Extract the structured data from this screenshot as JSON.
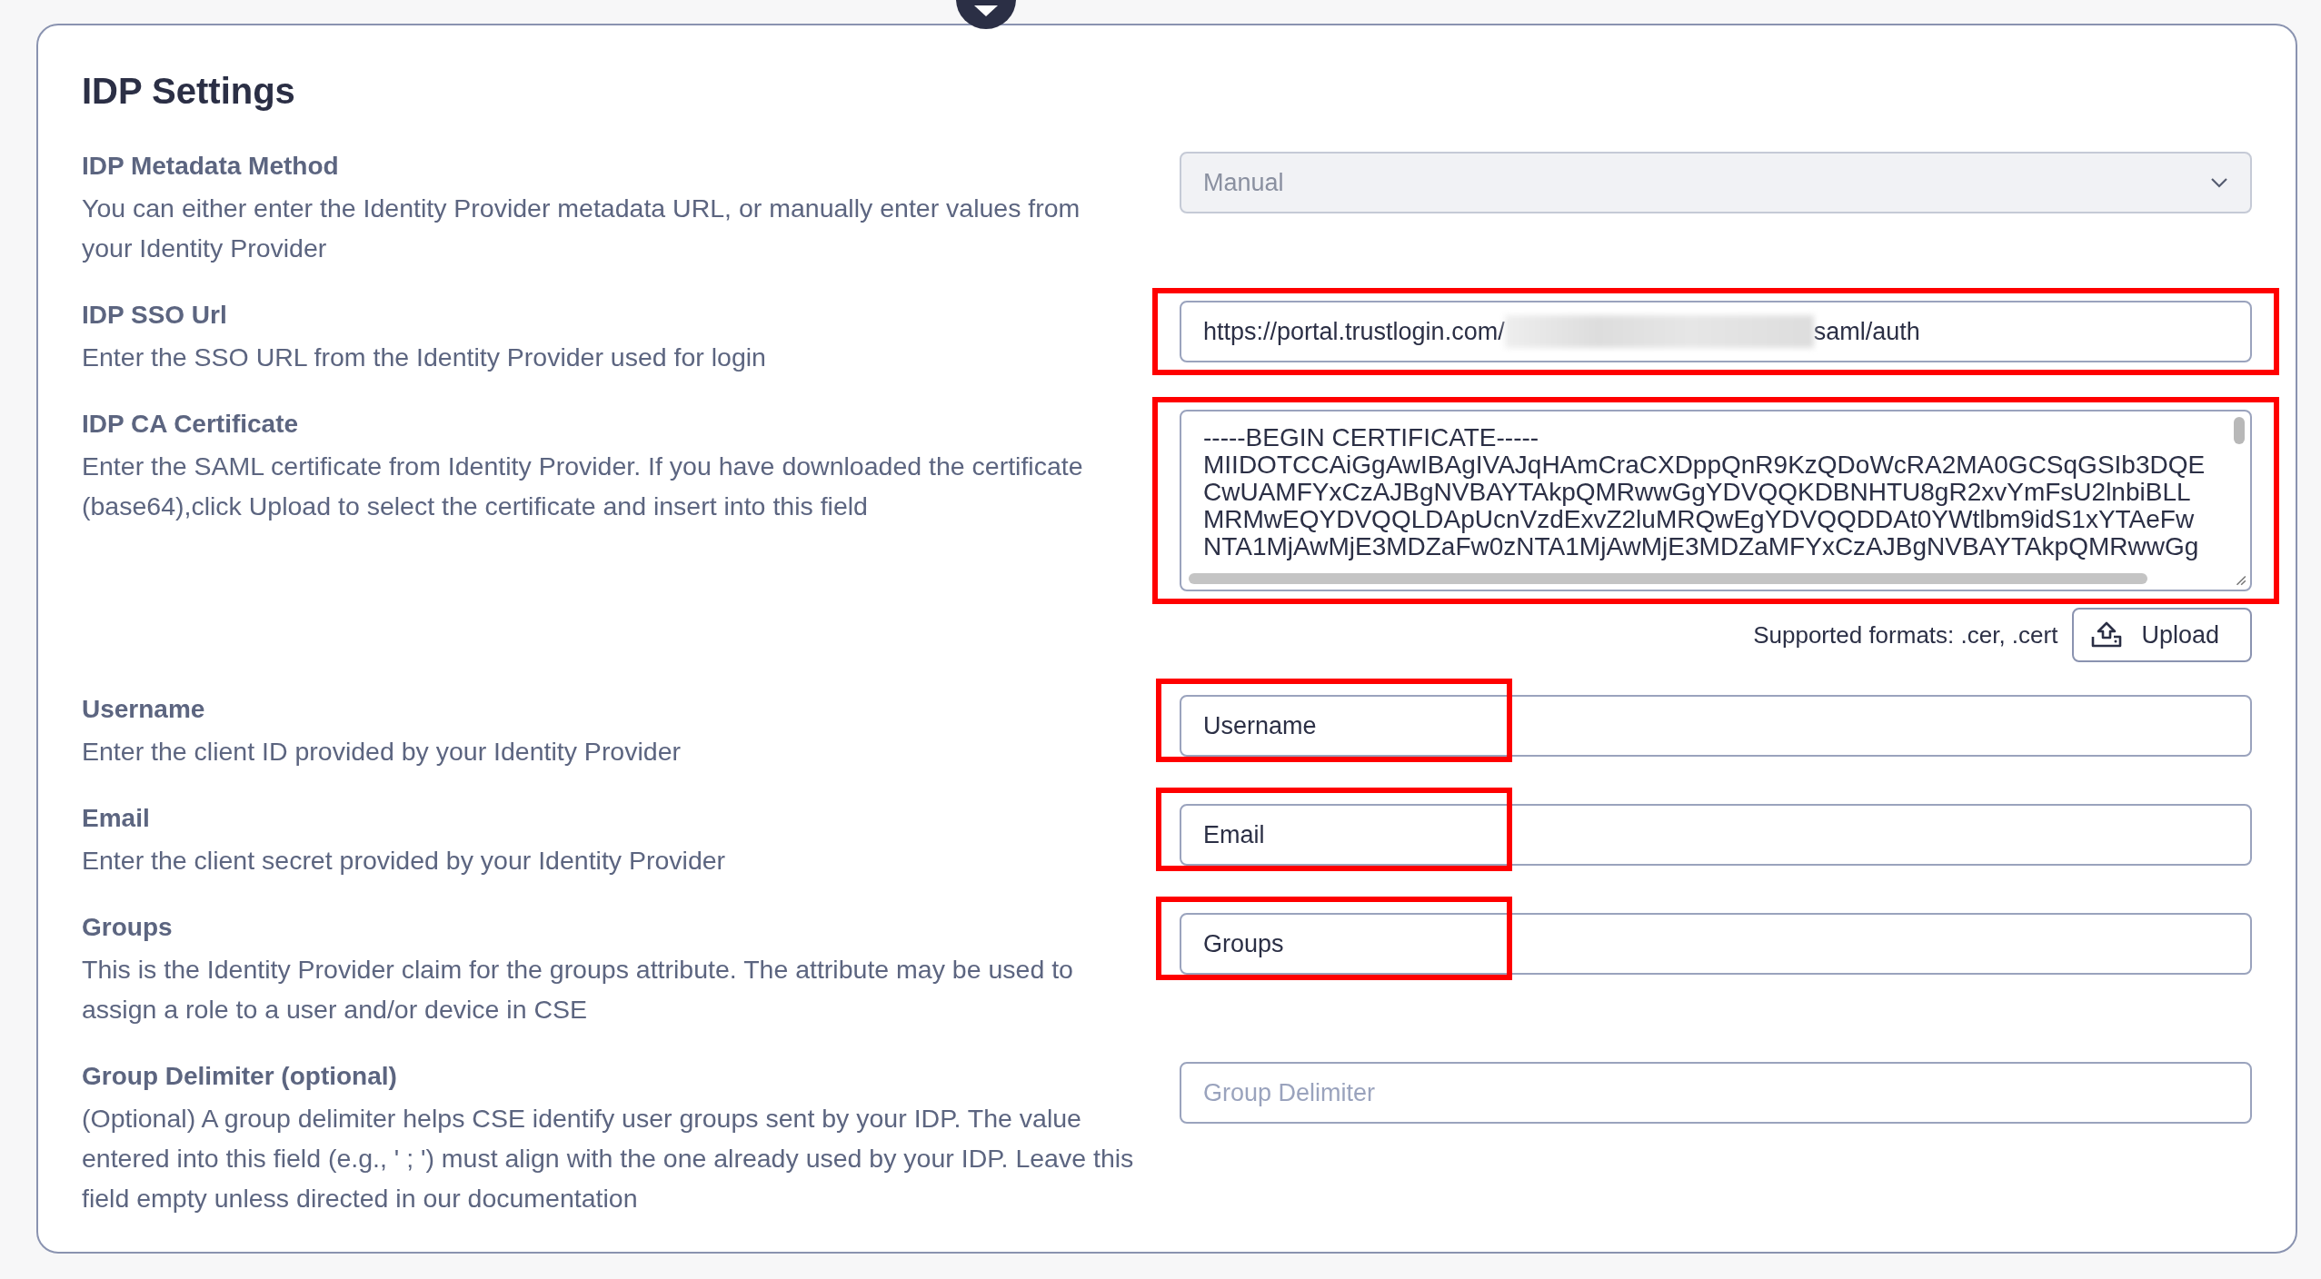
{
  "title": "IDP Settings",
  "settings": [
    {
      "kind": "select",
      "label": "IDP Metadata Method",
      "description": "You can either enter the Identity Provider metadata URL, or manually enter values from your Identity Provider",
      "value": "Manual",
      "disabled": true
    },
    {
      "kind": "url",
      "label": "IDP SSO Url",
      "description": "Enter the SSO URL from the Identity Provider used for login",
      "value_start": "https://portal.trustlogin.com/",
      "redacted": true,
      "value_end": "saml/auth",
      "highlighted": true
    },
    {
      "kind": "certificate",
      "label": "IDP CA Certificate",
      "description": "Enter the SAML certificate from Identity Provider. If you have downloaded the certificate (base64),click Upload to select the certificate and insert into this field",
      "lines": [
        "-----BEGIN CERTIFICATE-----",
        "MIIDOTCCAiGgAwIBAgIVAJqHAmCraCXDppQnR9KzQDoWcRA2MA0GCSqGSIb3DQE",
        "CwUAMFYxCzAJBgNVBAYTAkpQMRwwGgYDVQQKDBNHTU8gR2xvYmFsU2lnbiBLL",
        "MRMwEQYDVQQLDApUcnVzdExvZ2luMRQwEgYDVQQDDAt0YWtlbm9idS1xYTAeFw",
        "NTA1MjAwMjE3MDZaFw0zNTA1MjAwMjE3MDZaMFYxCzAJBgNVBAYTAkpQMRwwGg"
      ],
      "highlighted": true,
      "formats": "Supported formats: .cer, .cert",
      "upload": "Upload"
    },
    {
      "kind": "text",
      "label": "Username",
      "description": "Enter the client ID provided by your Identity Provider",
      "value": "Username",
      "highlighted": true
    },
    {
      "kind": "text",
      "label": "Email",
      "description": "Enter the client secret provided by your Identity Provider",
      "value": "Email",
      "highlighted": true
    },
    {
      "kind": "text",
      "label": "Groups",
      "description": "This is the Identity Provider claim for the groups attribute. The attribute may be used to assign a role to a user and/or device in CSE",
      "value": "Groups",
      "highlighted": true
    },
    {
      "kind": "text",
      "label": "Group Delimiter (optional)",
      "description": "(Optional) A group delimiter helps CSE identify user groups sent by your IDP. The value entered into this field (e.g., ' ; ') must align with the one already used by your IDP. Leave this field empty unless directed in our documentation",
      "placeholder": "Group Delimiter"
    }
  ]
}
